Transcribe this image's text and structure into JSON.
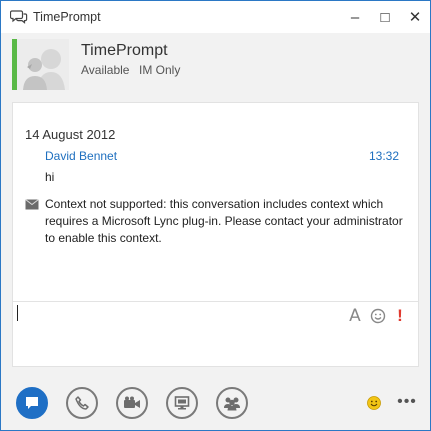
{
  "window": {
    "title": "TimePrompt",
    "controls": {
      "minimize": "–",
      "maximize": "□",
      "close": "✕"
    }
  },
  "contact": {
    "name": "TimePrompt",
    "status": "Available",
    "mode": "IM Only",
    "presence_color": "#5ab947"
  },
  "conversation": {
    "date": "14 August 2012",
    "messages": [
      {
        "sender": "David Bennet",
        "time": "13:32",
        "text": "hi"
      }
    ],
    "system_notice": "Context not supported: this conversation includes context which requires a Microsoft Lync plug-in. Please contact your administrator to enable this context."
  },
  "compose": {
    "value": "",
    "font_label": "A",
    "important_label": "!"
  },
  "toolbar": {
    "buttons": [
      "im-button",
      "call-button",
      "video-button",
      "present-button",
      "people-button"
    ],
    "more_label": "•••"
  },
  "colors": {
    "accent": "#1f6fc5",
    "link": "#1e6fbf",
    "important": "#e03a2f"
  }
}
